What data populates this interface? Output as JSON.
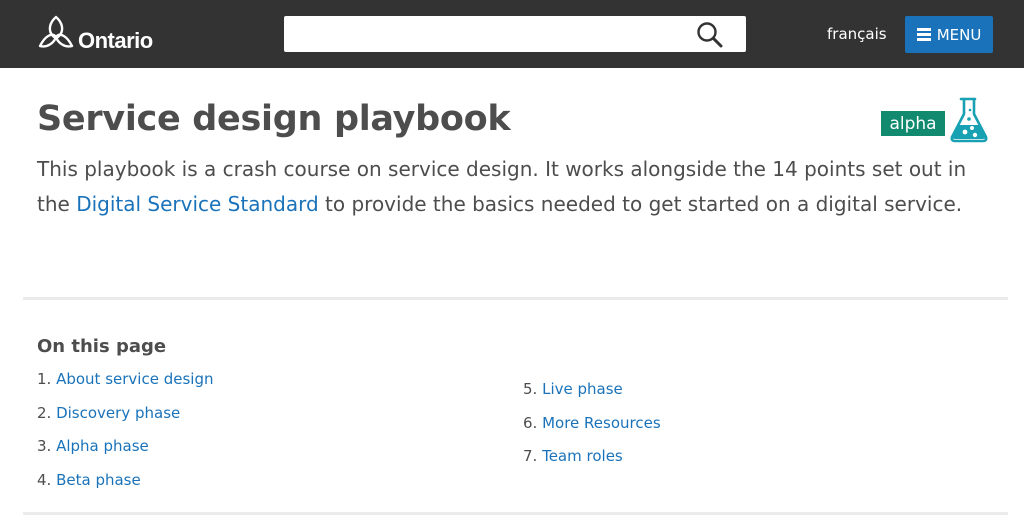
{
  "header": {
    "logo_text": "Ontario",
    "search": {
      "placeholder": "",
      "value": ""
    },
    "language_link": "français",
    "menu_label": "MENU",
    "colors": {
      "bar": "#333333",
      "menu_button": "#1a73ba"
    }
  },
  "main": {
    "title": "Service design playbook",
    "status_badge": "alpha",
    "intro": {
      "before_link": "This playbook is a crash course on service design. It works alongside the 14 points set out in the ",
      "link_text": "Digital Service Standard",
      "after_link": " to provide the basics needed to get started on a digital service."
    },
    "toc": {
      "title": "On this page",
      "items": [
        {
          "num": "1.",
          "label": "About service design"
        },
        {
          "num": "2.",
          "label": "Discovery phase"
        },
        {
          "num": "3.",
          "label": "Alpha phase"
        },
        {
          "num": "4.",
          "label": "Beta phase"
        },
        {
          "num": "5.",
          "label": "Live phase"
        },
        {
          "num": "6.",
          "label": "More Resources"
        },
        {
          "num": "7.",
          "label": "Team roles"
        }
      ]
    },
    "colors": {
      "link": "#1a73ba",
      "badge": "#118a6f",
      "flask": "#18a0b3"
    }
  },
  "icons": [
    "trillium-logo-icon",
    "search-icon",
    "hamburger-icon",
    "flask-icon"
  ]
}
